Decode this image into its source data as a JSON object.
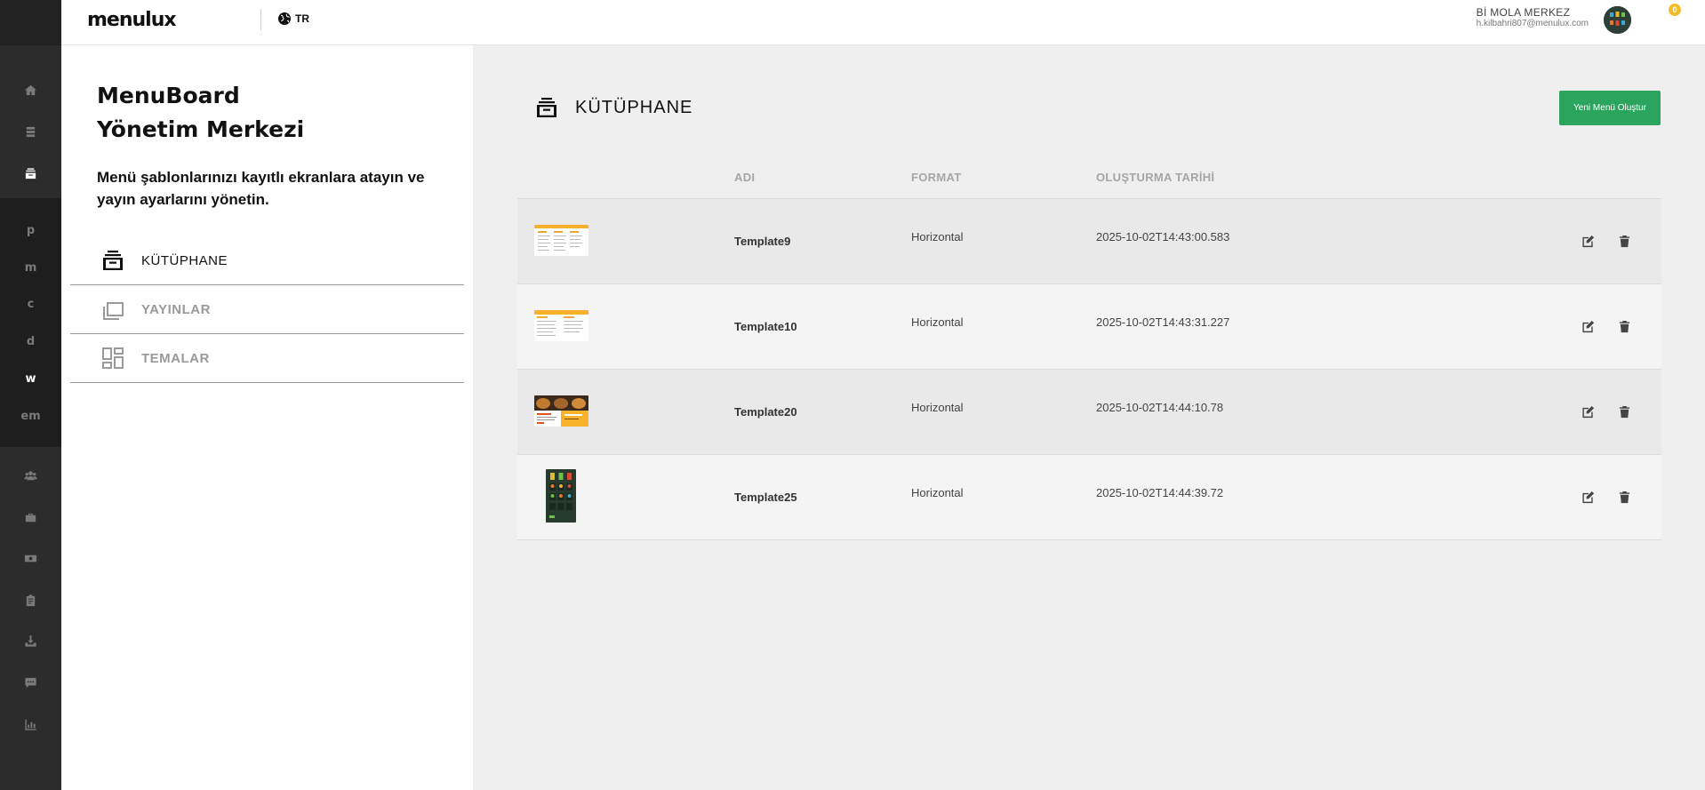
{
  "header": {
    "logo": "menulux",
    "language": "TR",
    "user_name": "Bİ MOLA MERKEZ",
    "user_email": "h.kilbahri807@menulux.com",
    "notification_count": "0"
  },
  "rail": {
    "letters": [
      "p",
      "m",
      "c",
      "d",
      "w",
      "em"
    ],
    "active_letter": "w",
    "icons": [
      "home-icon",
      "list-icon",
      "library-icon",
      "users-icon",
      "briefcase-icon",
      "money-icon",
      "clipboard-icon",
      "download-icon",
      "chat-icon",
      "chart-icon"
    ]
  },
  "panel": {
    "title_line1": "MenuBoard",
    "title_line2": "Yönetim Merkezi",
    "description": "Menü şablonlarınızı kayıtlı ekranlara atayın ve yayın ayarlarını yönetin.",
    "nav": [
      {
        "label": "KÜTÜPHANE",
        "icon": "library-icon",
        "active": true
      },
      {
        "label": "YAYINLAR",
        "icon": "screens-icon",
        "active": false
      },
      {
        "label": "TEMALAR",
        "icon": "themes-icon",
        "active": false
      }
    ]
  },
  "main": {
    "title": "KÜTÜPHANE",
    "new_button": "Yeni Menü Oluştur",
    "columns": {
      "name": "ADI",
      "format": "FORMAT",
      "created": "OLUŞTURMA TARİHİ"
    },
    "rows": [
      {
        "name": "Template9",
        "format": "Horizontal",
        "created": "2025-10-02T14:43:00.583"
      },
      {
        "name": "Template10",
        "format": "Horizontal",
        "created": "2025-10-02T14:43:31.227"
      },
      {
        "name": "Template20",
        "format": "Horizontal",
        "created": "2025-10-02T14:44:10.78"
      },
      {
        "name": "Template25",
        "format": "Horizontal",
        "created": "2025-10-02T14:44:39.72"
      }
    ]
  },
  "colors": {
    "accent_green": "#2ba55e",
    "rail_bg": "#2c2c2c",
    "badge": "#f2bd2d"
  }
}
